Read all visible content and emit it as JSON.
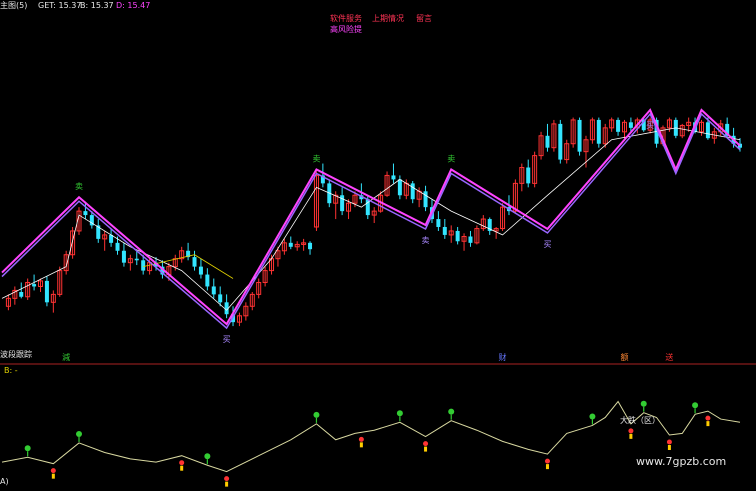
{
  "header": {
    "title": "主图(5)",
    "get_label": "GET: 15.37",
    "b_label": "B: 15.37",
    "d_label": "D: 15.47"
  },
  "menu": {
    "links": [
      "软件服务",
      "上期情况",
      "留言"
    ],
    "subtitle": "高风险提"
  },
  "lower_panel": {
    "title": "B: -",
    "axis_label": "A)",
    "annotation": "大跌（区）"
  },
  "watermark": "www.7gpzb.com",
  "colors": {
    "background": "#000000",
    "bull_candle": "#ff3333",
    "bear_candle": "#33e5ff",
    "zigzag": "#ff44ff",
    "zigzag_inner": "#9966ff",
    "ma_line": "#ffffff",
    "ma_line2": "#e0d000",
    "divider": "#aa2222",
    "signal_green": "#33cc33",
    "signal_red": "#ff3333"
  },
  "chart_data": [
    {
      "type": "candlestick",
      "x": [
        1,
        2,
        3,
        4,
        5,
        6,
        7,
        8,
        9,
        10,
        11,
        12,
        13,
        14,
        15,
        16,
        17,
        18,
        19,
        20,
        21,
        22,
        23,
        24,
        25,
        26,
        27,
        28,
        29,
        30,
        31,
        32,
        33,
        34,
        35,
        36,
        37,
        38,
        39,
        40,
        41,
        42,
        43,
        44,
        45,
        46,
        47,
        48,
        49,
        50,
        51,
        52,
        53,
        54,
        55,
        56,
        57,
        58,
        59,
        60,
        61,
        62,
        63,
        64,
        65,
        66,
        67,
        68,
        69,
        70,
        71,
        72,
        73,
        74,
        75,
        76,
        77,
        78,
        79,
        80,
        81,
        82,
        83,
        84,
        85,
        86,
        87,
        88,
        89,
        90,
        91,
        92,
        93,
        94,
        95,
        96,
        97,
        98,
        99,
        100,
        101,
        102,
        103,
        104,
        105,
        106,
        107,
        108,
        109,
        110,
        111,
        112,
        113,
        114,
        115
      ],
      "ohlc": [
        [
          13.6,
          13.75,
          13.55,
          13.7
        ],
        [
          13.7,
          13.85,
          13.62,
          13.8
        ],
        [
          13.78,
          13.9,
          13.7,
          13.72
        ],
        [
          13.72,
          13.95,
          13.68,
          13.9
        ],
        [
          13.88,
          14.0,
          13.8,
          13.85
        ],
        [
          13.85,
          13.95,
          13.78,
          13.92
        ],
        [
          13.92,
          13.98,
          13.6,
          13.65
        ],
        [
          13.65,
          13.8,
          13.52,
          13.75
        ],
        [
          13.75,
          14.1,
          13.72,
          14.05
        ],
        [
          14.05,
          14.3,
          14.0,
          14.25
        ],
        [
          14.25,
          14.6,
          14.2,
          14.55
        ],
        [
          14.55,
          14.85,
          14.5,
          14.8
        ],
        [
          14.8,
          14.92,
          14.7,
          14.75
        ],
        [
          14.75,
          14.8,
          14.58,
          14.62
        ],
        [
          14.62,
          14.7,
          14.4,
          14.45
        ],
        [
          14.45,
          14.55,
          14.3,
          14.5
        ],
        [
          14.5,
          14.58,
          14.35,
          14.4
        ],
        [
          14.4,
          14.48,
          14.25,
          14.3
        ],
        [
          14.3,
          14.4,
          14.1,
          14.15
        ],
        [
          14.15,
          14.25,
          14.05,
          14.2
        ],
        [
          14.2,
          14.3,
          14.12,
          14.18
        ],
        [
          14.18,
          14.25,
          14.0,
          14.05
        ],
        [
          14.05,
          14.2,
          14.0,
          14.15
        ],
        [
          14.15,
          14.22,
          14.05,
          14.1
        ],
        [
          14.1,
          14.18,
          13.95,
          14.0
        ],
        [
          14.0,
          14.15,
          13.92,
          14.1
        ],
        [
          14.1,
          14.25,
          14.05,
          14.2
        ],
        [
          14.2,
          14.35,
          14.15,
          14.3
        ],
        [
          14.3,
          14.4,
          14.18,
          14.22
        ],
        [
          14.22,
          14.3,
          14.05,
          14.1
        ],
        [
          14.1,
          14.2,
          13.95,
          14.0
        ],
        [
          14.0,
          14.08,
          13.8,
          13.85
        ],
        [
          13.85,
          13.95,
          13.7,
          13.75
        ],
        [
          13.75,
          13.85,
          13.6,
          13.65
        ],
        [
          13.65,
          13.75,
          13.45,
          13.5
        ],
        [
          13.5,
          13.6,
          13.35,
          13.4
        ],
        [
          13.4,
          13.52,
          13.35,
          13.48
        ],
        [
          13.48,
          13.65,
          13.42,
          13.6
        ],
        [
          13.6,
          13.78,
          13.55,
          13.75
        ],
        [
          13.75,
          13.95,
          13.7,
          13.9
        ],
        [
          13.9,
          14.1,
          13.85,
          14.05
        ],
        [
          14.05,
          14.25,
          14.0,
          14.2
        ],
        [
          14.2,
          14.35,
          14.1,
          14.3
        ],
        [
          14.3,
          14.45,
          14.25,
          14.4
        ],
        [
          14.4,
          14.48,
          14.32,
          14.35
        ],
        [
          14.35,
          14.42,
          14.3,
          14.38
        ],
        [
          14.38,
          14.45,
          14.3,
          14.4
        ],
        [
          14.4,
          14.42,
          14.25,
          14.32
        ],
        [
          14.6,
          15.3,
          14.55,
          15.25
        ],
        [
          15.25,
          15.4,
          15.1,
          15.15
        ],
        [
          15.15,
          15.2,
          14.85,
          14.9
        ],
        [
          14.9,
          15.05,
          14.7,
          15.0
        ],
        [
          15.0,
          15.1,
          14.75,
          14.8
        ],
        [
          14.8,
          14.95,
          14.7,
          14.9
        ],
        [
          14.9,
          15.05,
          14.85,
          15.0
        ],
        [
          15.0,
          15.15,
          14.9,
          14.95
        ],
        [
          14.95,
          15.0,
          14.7,
          14.75
        ],
        [
          14.75,
          14.85,
          14.65,
          14.8
        ],
        [
          14.8,
          15.05,
          14.78,
          15.0
        ],
        [
          15.0,
          15.3,
          14.98,
          15.25
        ],
        [
          15.25,
          15.4,
          15.15,
          15.2
        ],
        [
          15.2,
          15.25,
          14.95,
          15.0
        ],
        [
          15.0,
          15.2,
          14.95,
          15.15
        ],
        [
          15.15,
          15.18,
          14.9,
          14.95
        ],
        [
          14.95,
          15.1,
          14.85,
          15.05
        ],
        [
          15.05,
          15.12,
          14.8,
          14.85
        ],
        [
          14.85,
          14.95,
          14.65,
          14.7
        ],
        [
          14.7,
          14.8,
          14.55,
          14.6
        ],
        [
          14.6,
          14.7,
          14.45,
          14.5
        ],
        [
          14.5,
          14.62,
          14.4,
          14.55
        ],
        [
          14.55,
          14.6,
          14.38,
          14.42
        ],
        [
          14.42,
          14.52,
          14.3,
          14.48
        ],
        [
          14.48,
          14.55,
          14.35,
          14.4
        ],
        [
          14.4,
          14.62,
          14.38,
          14.58
        ],
        [
          14.58,
          14.75,
          14.55,
          14.7
        ],
        [
          14.7,
          14.72,
          14.5,
          14.55
        ],
        [
          14.55,
          14.6,
          14.45,
          14.58
        ],
        [
          14.58,
          14.9,
          14.55,
          14.85
        ],
        [
          14.85,
          15.0,
          14.75,
          14.8
        ],
        [
          14.8,
          15.2,
          14.78,
          15.15
        ],
        [
          15.15,
          15.4,
          15.05,
          15.35
        ],
        [
          15.35,
          15.45,
          15.1,
          15.15
        ],
        [
          15.15,
          15.55,
          15.1,
          15.5
        ],
        [
          15.5,
          15.8,
          15.45,
          15.75
        ],
        [
          15.75,
          15.9,
          15.55,
          15.6
        ],
        [
          15.6,
          15.95,
          15.55,
          15.9
        ],
        [
          15.9,
          15.95,
          15.4,
          15.45
        ],
        [
          15.45,
          15.7,
          15.4,
          15.65
        ],
        [
          15.65,
          15.98,
          15.6,
          15.95
        ],
        [
          15.95,
          15.98,
          15.5,
          15.55
        ],
        [
          15.55,
          15.75,
          15.35,
          15.7
        ],
        [
          15.7,
          15.98,
          15.65,
          15.95
        ],
        [
          15.95,
          15.98,
          15.6,
          15.65
        ],
        [
          15.65,
          15.9,
          15.6,
          15.85
        ],
        [
          15.85,
          15.98,
          15.8,
          15.95
        ],
        [
          15.95,
          15.98,
          15.75,
          15.8
        ],
        [
          15.8,
          15.95,
          15.7,
          15.92
        ],
        [
          15.92,
          15.98,
          15.8,
          15.85
        ],
        [
          15.85,
          15.98,
          15.78,
          15.95
        ],
        [
          15.95,
          15.98,
          15.8,
          15.82
        ],
        [
          15.82,
          15.98,
          15.78,
          15.95
        ],
        [
          15.95,
          15.98,
          15.6,
          15.65
        ],
        [
          15.65,
          15.88,
          15.62,
          15.85
        ],
        [
          15.85,
          15.98,
          15.8,
          15.95
        ],
        [
          15.95,
          15.98,
          15.72,
          15.75
        ],
        [
          15.75,
          15.9,
          15.72,
          15.88
        ],
        [
          15.88,
          15.98,
          15.8,
          15.92
        ],
        [
          15.92,
          15.98,
          15.78,
          15.8
        ],
        [
          15.8,
          15.95,
          15.75,
          15.92
        ],
        [
          15.92,
          15.98,
          15.7,
          15.72
        ],
        [
          15.72,
          15.85,
          15.65,
          15.8
        ],
        [
          15.8,
          15.95,
          15.75,
          15.9
        ],
        [
          15.9,
          15.98,
          15.72,
          15.75
        ],
        [
          15.75,
          15.85,
          15.6,
          15.65
        ],
        [
          15.65,
          15.72,
          15.55,
          15.6
        ]
      ],
      "zigzag": [
        [
          0,
          14.0
        ],
        [
          12,
          14.95
        ],
        [
          35,
          13.35
        ],
        [
          49,
          15.3
        ],
        [
          66,
          14.6
        ],
        [
          70,
          15.3
        ],
        [
          85,
          14.55
        ],
        [
          101,
          16.05
        ],
        [
          105,
          15.3
        ],
        [
          109,
          16.05
        ],
        [
          115,
          15.6
        ]
      ],
      "ma": [
        [
          0,
          13.7
        ],
        [
          10,
          14.1
        ],
        [
          12,
          14.75
        ],
        [
          20,
          14.35
        ],
        [
          28,
          14.05
        ],
        [
          35,
          13.55
        ],
        [
          42,
          14.2
        ],
        [
          49,
          15.1
        ],
        [
          56,
          14.85
        ],
        [
          62,
          15.2
        ],
        [
          70,
          14.8
        ],
        [
          78,
          14.5
        ],
        [
          85,
          15.0
        ],
        [
          95,
          15.7
        ],
        [
          105,
          15.85
        ],
        [
          115,
          15.7
        ]
      ],
      "ma2": [
        [
          22,
          14.1
        ],
        [
          30,
          14.25
        ],
        [
          36,
          13.95
        ]
      ],
      "tags": [
        {
          "x": 12,
          "label": "卖",
          "pos": "top"
        },
        {
          "x": 35,
          "label": "买",
          "pos": "bottom"
        },
        {
          "x": 49,
          "label": "卖",
          "pos": "top"
        },
        {
          "x": 66,
          "label": "卖",
          "pos": "bottom"
        },
        {
          "x": 70,
          "label": "卖",
          "pos": "top"
        },
        {
          "x": 85,
          "label": "买",
          "pos": "bottom"
        },
        {
          "x": 101,
          "label": "买",
          "pos": "bottom"
        }
      ],
      "bottom_markers": [
        {
          "x": 10,
          "label": "減",
          "color": "#33cc33"
        },
        {
          "x": 78,
          "label": "财",
          "color": "#6677ff"
        },
        {
          "x": 97,
          "label": "额",
          "color": "#ff8833"
        },
        {
          "x": 104,
          "label": "送",
          "color": "#ff3333"
        }
      ],
      "ylim": [
        13.2,
        16.05
      ],
      "left_label": "波段跟踪"
    },
    {
      "type": "line",
      "x": [
        0,
        4,
        8,
        12,
        16,
        20,
        24,
        28,
        32,
        35,
        40,
        45,
        49,
        52,
        55,
        58,
        62,
        66,
        70,
        74,
        78,
        82,
        85,
        88,
        92,
        94,
        96,
        98,
        100,
        102,
        104,
        106,
        108,
        110,
        112,
        115
      ],
      "values": [
        14.7,
        14.85,
        14.65,
        15.3,
        15.0,
        14.8,
        14.7,
        14.9,
        14.6,
        14.4,
        14.9,
        15.4,
        15.9,
        15.4,
        15.6,
        15.7,
        15.95,
        15.5,
        16.0,
        15.7,
        15.35,
        15.1,
        14.95,
        15.6,
        15.85,
        16.1,
        16.6,
        15.9,
        16.25,
        16.1,
        15.55,
        15.6,
        16.2,
        16.3,
        16.05,
        15.95
      ],
      "ylim": [
        14.2,
        16.9
      ],
      "signals": [
        {
          "x": 4,
          "type": "buy"
        },
        {
          "x": 8,
          "type": "sell"
        },
        {
          "x": 12,
          "type": "buy"
        },
        {
          "x": 28,
          "type": "sell"
        },
        {
          "x": 32,
          "type": "buy"
        },
        {
          "x": 35,
          "type": "sell"
        },
        {
          "x": 49,
          "type": "buy"
        },
        {
          "x": 56,
          "type": "sell"
        },
        {
          "x": 62,
          "type": "buy"
        },
        {
          "x": 66,
          "type": "sell"
        },
        {
          "x": 70,
          "type": "buy"
        },
        {
          "x": 85,
          "type": "sell"
        },
        {
          "x": 92,
          "type": "buy"
        },
        {
          "x": 98,
          "type": "sell"
        },
        {
          "x": 100,
          "type": "buy"
        },
        {
          "x": 104,
          "type": "sell"
        },
        {
          "x": 108,
          "type": "buy"
        },
        {
          "x": 110,
          "type": "sell"
        }
      ]
    }
  ]
}
